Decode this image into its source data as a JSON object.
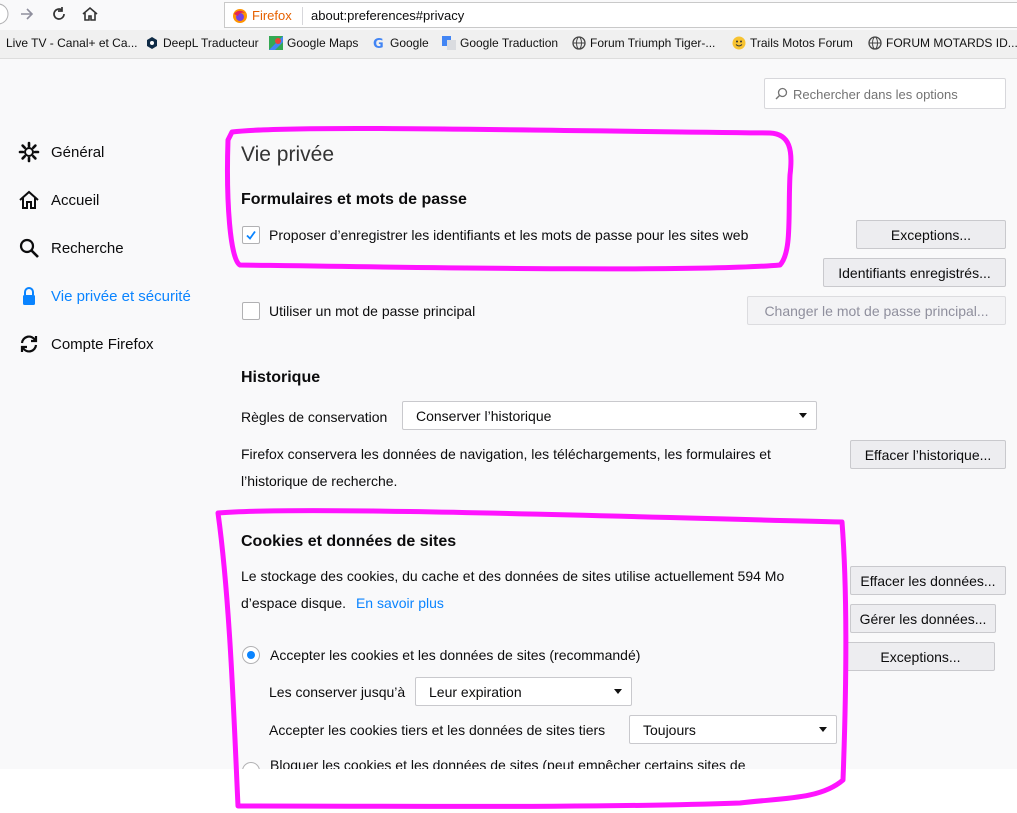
{
  "nav": {
    "brand": "Firefox",
    "url": "about:preferences#privacy"
  },
  "bookmarks": [
    {
      "label": "Live TV - Canal+ et Ca...",
      "icon": "none"
    },
    {
      "label": "DeepL Traducteur",
      "icon": "deepl-icon"
    },
    {
      "label": "Google Maps",
      "icon": "google-maps-icon"
    },
    {
      "label": "Google",
      "icon": "google-icon"
    },
    {
      "label": "Google Traduction",
      "icon": "google-translate-icon"
    },
    {
      "label": "Forum Triumph Tiger-...",
      "icon": "globe-icon"
    },
    {
      "label": "Trails Motos Forum",
      "icon": "smiley-icon"
    },
    {
      "label": "FORUM MOTARDS ID...",
      "icon": "globe-icon"
    }
  ],
  "search": {
    "placeholder": "Rechercher dans les options"
  },
  "sidebar": [
    {
      "label": "Général",
      "icon": "gear-icon",
      "selected": false
    },
    {
      "label": "Accueil",
      "icon": "home-icon",
      "selected": false
    },
    {
      "label": "Recherche",
      "icon": "search-icon",
      "selected": false
    },
    {
      "label": "Vie privée et sécurité",
      "icon": "lock-icon",
      "selected": true
    },
    {
      "label": "Compte Firefox",
      "icon": "sync-icon",
      "selected": false
    }
  ],
  "privacy": {
    "title": "Vie privée",
    "forms": {
      "heading": "Formulaires et mots de passe",
      "save_logins_label": "Proposer d’enregistrer les identifiants et les mots de passe pour les sites web",
      "save_logins_checked": true,
      "exceptions_btn": "Exceptions...",
      "saved_logins_btn": "Identifiants enregistrés...",
      "master_pw_label": "Utiliser un mot de passe principal",
      "master_pw_checked": false,
      "change_master_btn": "Changer le mot de passe principal..."
    },
    "history": {
      "heading": "Historique",
      "rules_label": "Règles de conservation",
      "rules_value": "Conserver l’historique",
      "description_line1": "Firefox conservera les données de navigation, les téléchargements, les formulaires et",
      "description_line2": "l’historique de recherche.",
      "clear_btn": "Effacer l’historique..."
    },
    "cookies": {
      "heading": "Cookies et données de sites",
      "usage_line1": "Le stockage des cookies, du cache et des données de sites utilise actuellement 594 Mo",
      "usage_line2": "d’espace disque.",
      "learn_more": "En savoir plus",
      "clear_btn": "Effacer les données...",
      "manage_btn": "Gérer les données...",
      "exceptions_btn": "Exceptions...",
      "accept_label": "Accepter les cookies et les données de sites (recommandé)",
      "keep_until_label": "Les conserver jusqu’à",
      "keep_until_value": "Leur expiration",
      "third_party_label": "Accepter les cookies tiers et les données de sites tiers",
      "third_party_value": "Toujours",
      "block_label": "Bloquer les cookies et les données de sites (peut empêcher certains sites de"
    }
  },
  "colors": {
    "accent": "#0a84ff",
    "annotation": "#ff14ff",
    "firefox_orange": "#e66000"
  }
}
